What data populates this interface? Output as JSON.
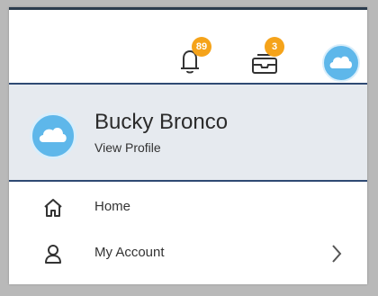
{
  "header": {
    "notifications": {
      "icon": "bell-icon",
      "count": "89"
    },
    "inbox": {
      "icon": "inbox-icon",
      "count": "3"
    },
    "avatar_icon": "cloud-icon"
  },
  "profile": {
    "name": "Bucky Bronco",
    "link": "View Profile",
    "avatar_icon": "cloud-icon"
  },
  "menu": {
    "items": [
      {
        "label": "Home",
        "icon": "home-icon",
        "has_chevron": false
      },
      {
        "label": "My Account",
        "icon": "user-icon",
        "has_chevron": true
      }
    ]
  },
  "colors": {
    "accent": "#f5a31a",
    "avatar": "#5eb7ea",
    "profile_bg": "#e6eaef",
    "profile_border": "#2f4a73",
    "topbar_border": "#2b3b4d"
  }
}
